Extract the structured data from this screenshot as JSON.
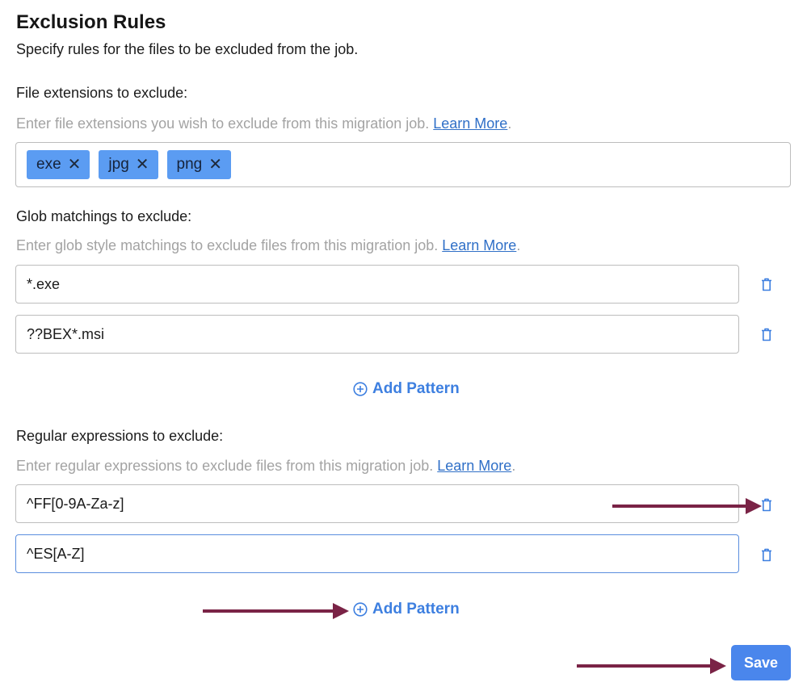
{
  "header": {
    "title": "Exclusion Rules",
    "subtitle": "Specify rules for the files to be excluded from the job."
  },
  "extensions": {
    "label": "File extensions to exclude:",
    "hint": "Enter file extensions you wish to exclude from this migration job.",
    "learn_more": "Learn More",
    "tags": [
      "exe",
      "jpg",
      "png"
    ],
    "remove_glyph": "✕"
  },
  "glob": {
    "label": "Glob matchings to exclude:",
    "hint": "Enter glob style matchings to exclude files from this migration job.",
    "learn_more": "Learn More",
    "patterns": [
      "*.exe",
      "??BEX*.msi"
    ],
    "add_label": "Add Pattern"
  },
  "regex": {
    "label": "Regular expressions to exclude:",
    "hint": "Enter regular expressions to exclude files from this migration job.",
    "learn_more": "Learn More",
    "patterns": [
      "^FF[0-9A-Za-z]",
      "^ES[A-Z]"
    ],
    "add_label": "Add Pattern"
  },
  "footer": {
    "save_label": "Save"
  },
  "icons": {
    "trash": "trash-icon",
    "add": "plus-circle-icon",
    "annotation": "arrow-icon"
  },
  "colors": {
    "accent": "#3d7fe0",
    "tag_bg": "#5b9cf2",
    "save_bg": "#4a86ec",
    "annotation_arrow": "#7a2346",
    "hint": "#a3a3a3"
  }
}
